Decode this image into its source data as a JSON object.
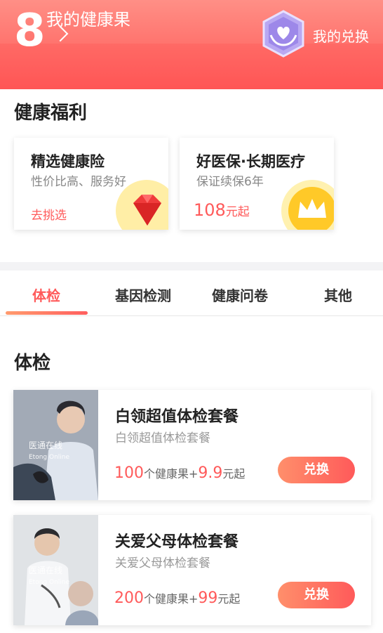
{
  "header": {
    "fruit_count": "8",
    "title": "我的健康果",
    "exchange_label": "我的兑换",
    "badge_icon": "heart-hands-icon"
  },
  "welfare": {
    "title": "健康福利",
    "cards": [
      {
        "title": "精选健康险",
        "subtitle": "性价比高、服务好",
        "action": "去挑选",
        "icon": "ruby-gem-icon"
      },
      {
        "title": "好医保·长期医疗",
        "subtitle": "保证续保6年",
        "price": "108",
        "price_unit": "元起",
        "icon": "crown-coin-icon"
      }
    ]
  },
  "tabs": [
    "体检",
    "基因检测",
    "健康问卷",
    "其他"
  ],
  "active_tab": 0,
  "list": {
    "title": "体检",
    "items": [
      {
        "title": "白领超值体检套餐",
        "subtitle": "白领超值体检套餐",
        "fruit": "100",
        "fruit_label": "个健康果+",
        "cash": "9.9",
        "cash_unit": "元起",
        "button": "兑换",
        "logo_text": "医通在线",
        "logo_sub": "Etong Online"
      },
      {
        "title": "关爱父母体检套餐",
        "subtitle": "关爱父母体检套餐",
        "fruit": "200",
        "fruit_label": "个健康果+",
        "cash": "99",
        "cash_unit": "元起",
        "button": "兑换",
        "logo_text": "医通在线",
        "logo_sub": "Etong Online"
      }
    ]
  },
  "colors": {
    "accent": "#ff5a5a",
    "header": "#ff7670"
  }
}
